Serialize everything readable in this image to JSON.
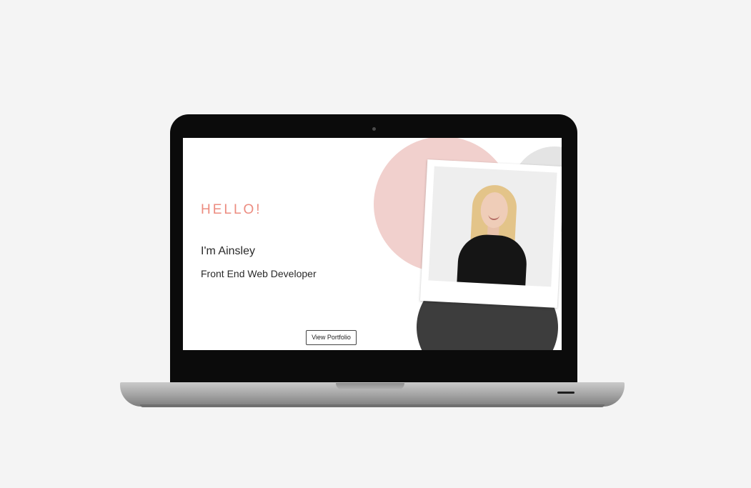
{
  "hero": {
    "greeting": "HELLO!",
    "name": "I'm Ainsley",
    "role": "Front End Web Developer",
    "cta_label": "View Portfolio"
  },
  "colors": {
    "accent": "#ec8c80",
    "pink_circle": "#f1d0cd",
    "gray_circle": "#e4e4e4",
    "dark_shape": "#3d3d3d",
    "page_background": "#f4f4f4"
  }
}
